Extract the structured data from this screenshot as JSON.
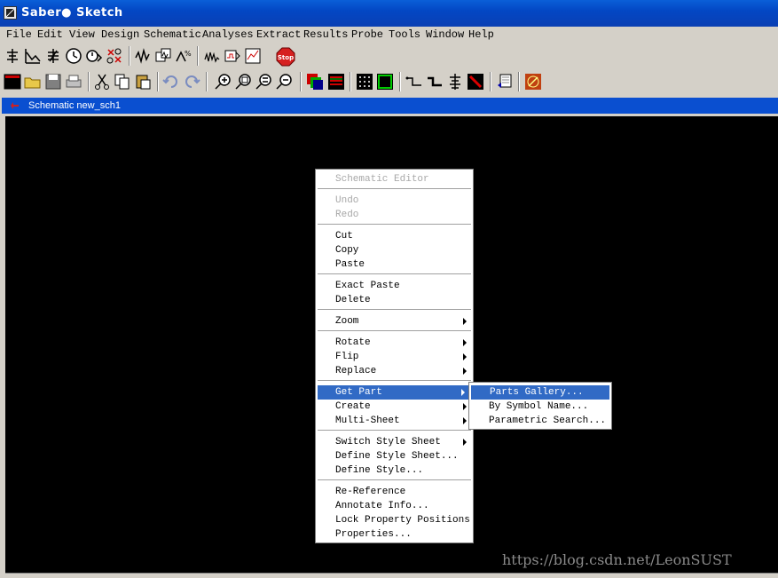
{
  "window": {
    "title": "Saber● Sketch"
  },
  "menubar": [
    {
      "label": "File"
    },
    {
      "label": "Edit"
    },
    {
      "label": "View"
    },
    {
      "label": "Design"
    },
    {
      "label": "Schematic"
    },
    {
      "label": "Analyses"
    },
    {
      "label": "Extract"
    },
    {
      "label": "Results"
    },
    {
      "label": "Probe"
    },
    {
      "label": "Tools"
    },
    {
      "label": "Window"
    },
    {
      "label": "Help"
    }
  ],
  "toolbar1": {
    "stop_label": "Stop"
  },
  "schematic_window": {
    "title": "Schematic new_sch1"
  },
  "context_menu": {
    "header": "Schematic Editor",
    "items": [
      {
        "label": "Undo",
        "enabled": false
      },
      {
        "label": "Redo",
        "enabled": false
      },
      {
        "label": "Cut"
      },
      {
        "label": "Copy"
      },
      {
        "label": "Paste"
      },
      {
        "label": "Exact Paste"
      },
      {
        "label": "Delete"
      },
      {
        "label": "Zoom",
        "submenu": true
      },
      {
        "label": "Rotate",
        "submenu": true
      },
      {
        "label": "Flip",
        "submenu": true
      },
      {
        "label": "Replace",
        "submenu": true
      },
      {
        "label": "Get Part",
        "submenu": true,
        "selected": true
      },
      {
        "label": "Create",
        "submenu": true
      },
      {
        "label": "Multi-Sheet",
        "submenu": true
      },
      {
        "label": "Switch Style Sheet",
        "submenu": true
      },
      {
        "label": "Define Style Sheet..."
      },
      {
        "label": "Define Style..."
      },
      {
        "label": "Re-Reference"
      },
      {
        "label": "Annotate Info..."
      },
      {
        "label": "Lock Property Positions"
      },
      {
        "label": "Properties..."
      }
    ]
  },
  "submenu": {
    "items": [
      {
        "label": "Parts Gallery...",
        "selected": true
      },
      {
        "label": "By Symbol Name..."
      },
      {
        "label": "Parametric Search..."
      }
    ]
  },
  "watermark": "https://blog.csdn.net/LeonSUST",
  "colors": {
    "title_blue": "#0a4fd0",
    "selection": "#316ac5",
    "canvas": "#000000",
    "stop_red": "#d62020"
  }
}
